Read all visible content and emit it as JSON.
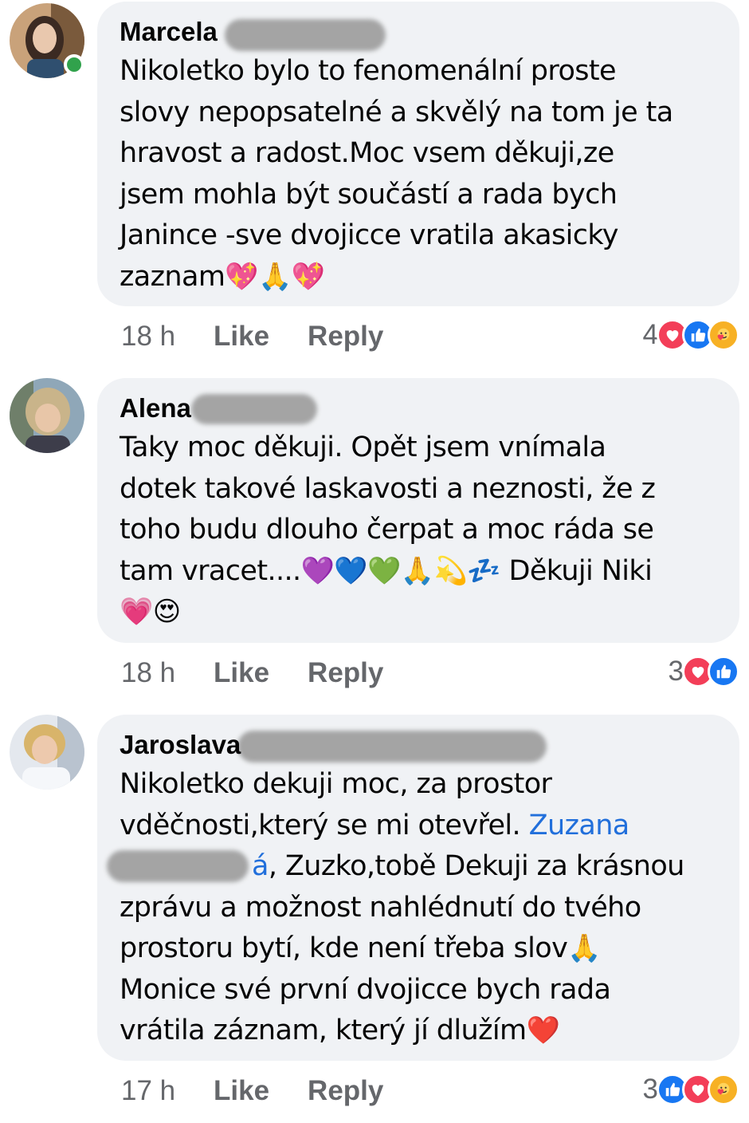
{
  "comments": [
    {
      "author": "Marcela",
      "lines": [
        "Nikoletko bylo to fenomenální proste",
        "slovy nepopsatelné a skvělý na tom je ta",
        "hravost a radost.Moc vsem děkuji,ze",
        "jsem mohla být součástí a rada bych",
        "Janince -sve dvojicce vratila akasicky"
      ],
      "last_line_text": "zaznam",
      "last_line_emoji": "💖🙏💖",
      "time": "18 h",
      "like": "Like",
      "reply": "Reply",
      "reaction_count": "4",
      "online": true
    },
    {
      "author": "Alena",
      "lines": [
        "Taky moc děkuji. Opět jsem vnímala",
        "dotek takové laskavosti a neznosti,  že z",
        "toho budu dlouho čerpat a moc ráda se"
      ],
      "line4_text": "tam vracet....",
      "line4_emoji": "💜💙💚🙏💫💤",
      "line4_tail": " Děkuji Niki",
      "line5_emoji": "💗😍",
      "time": "18 h",
      "like": "Like",
      "reply": "Reply",
      "reaction_count": "3"
    },
    {
      "author": "Jaroslava",
      "line1": "Nikoletko dekuji moc, za  prostor",
      "line2_text": "vděčnosti,který se mi otevřel. ",
      "line2_link": "Zuzana",
      "line3_link_tail": "á",
      "line3_text": ", Zuzko,tobě Dekuji za krásnou",
      "line4": "zprávu a možnost nahlédnutí  do tvého",
      "line5_text": "prostoru bytí, kde není třeba slov",
      "line5_emoji": "🙏",
      "line6": "Monice své první dvojicce bych rada",
      "line7_text": "vrátila záznam, který jí dlužím",
      "line7_emoji": "❤️",
      "time": "17 h",
      "like": "Like",
      "reply": "Reply",
      "reaction_count": "3"
    }
  ],
  "colors": {
    "bubble": "#f0f2f5",
    "meta": "#65676b",
    "link": "#216fdb",
    "love": "#f33e58",
    "like": "#1877f2",
    "care": "#f7b125",
    "online": "#31a24c"
  },
  "icons": [
    "love-reaction-icon",
    "like-reaction-icon",
    "care-reaction-icon"
  ]
}
